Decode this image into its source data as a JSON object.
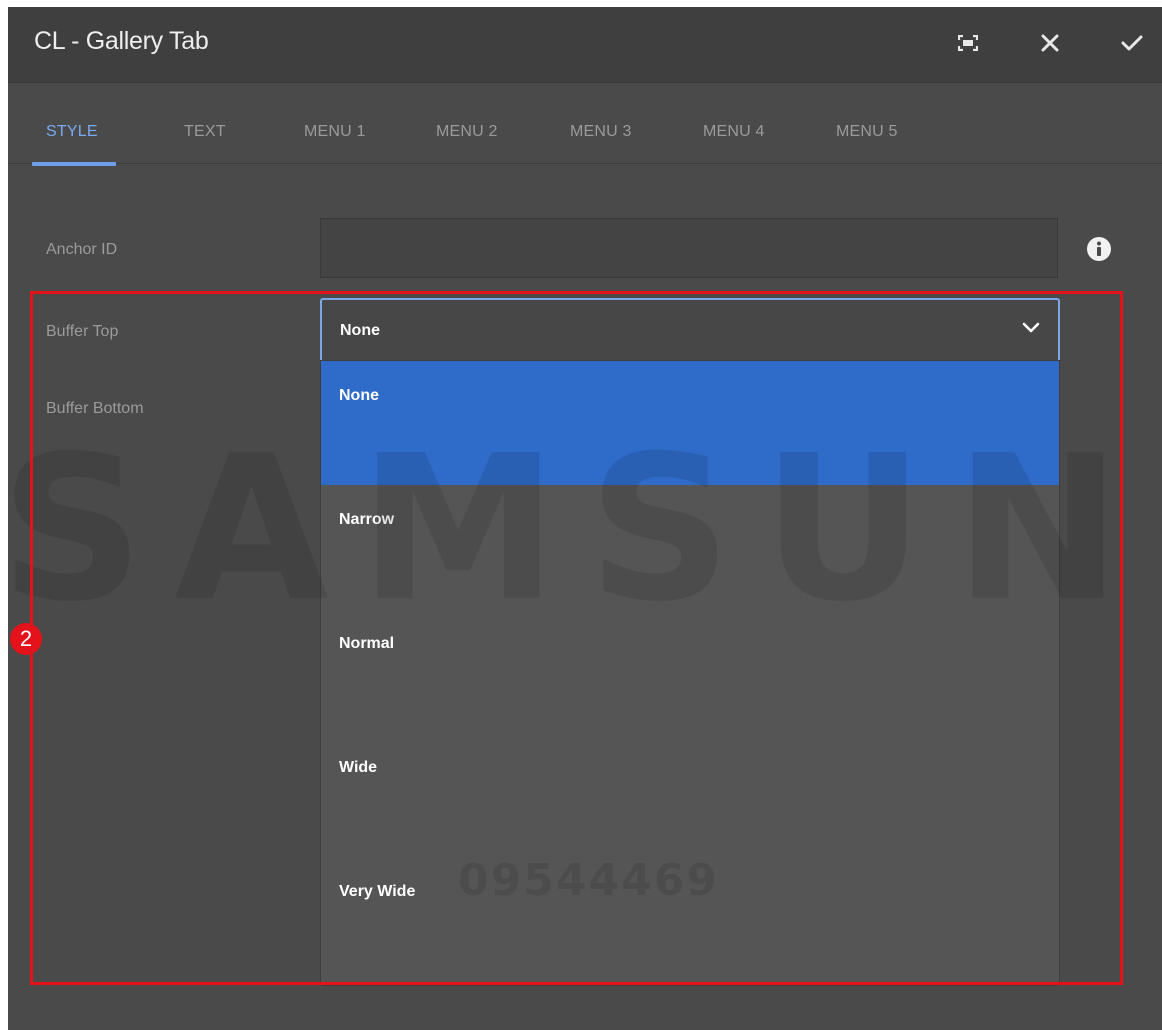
{
  "dialog": {
    "title": "CL - Gallery Tab",
    "buttons": {
      "fullscreen_icon": "fullscreen-icon",
      "close_icon": "close-icon",
      "confirm_icon": "check-icon"
    }
  },
  "tabs": [
    {
      "label": "STYLE",
      "active": true
    },
    {
      "label": "TEXT"
    },
    {
      "label": "MENU 1"
    },
    {
      "label": "MENU 2"
    },
    {
      "label": "MENU 3"
    },
    {
      "label": "MENU 4"
    },
    {
      "label": "MENU 5"
    }
  ],
  "form": {
    "anchor_id": {
      "label": "Anchor ID",
      "value": ""
    },
    "buffer_top": {
      "label": "Buffer Top",
      "value": "None",
      "options": [
        "None",
        "Narrow",
        "Normal",
        "Wide",
        "Very Wide"
      ],
      "selected_index": 0
    },
    "buffer_bottom": {
      "label": "Buffer Bottom"
    }
  },
  "annotation": {
    "badge": "2",
    "color": "#e3121b"
  },
  "watermark": {
    "brand": "SAMSUNG",
    "code": "09544469"
  },
  "colors": {
    "accent": "#7aaaf0",
    "selected_option": "#2f6bc8",
    "dialog_bg": "#4a4a4a"
  }
}
